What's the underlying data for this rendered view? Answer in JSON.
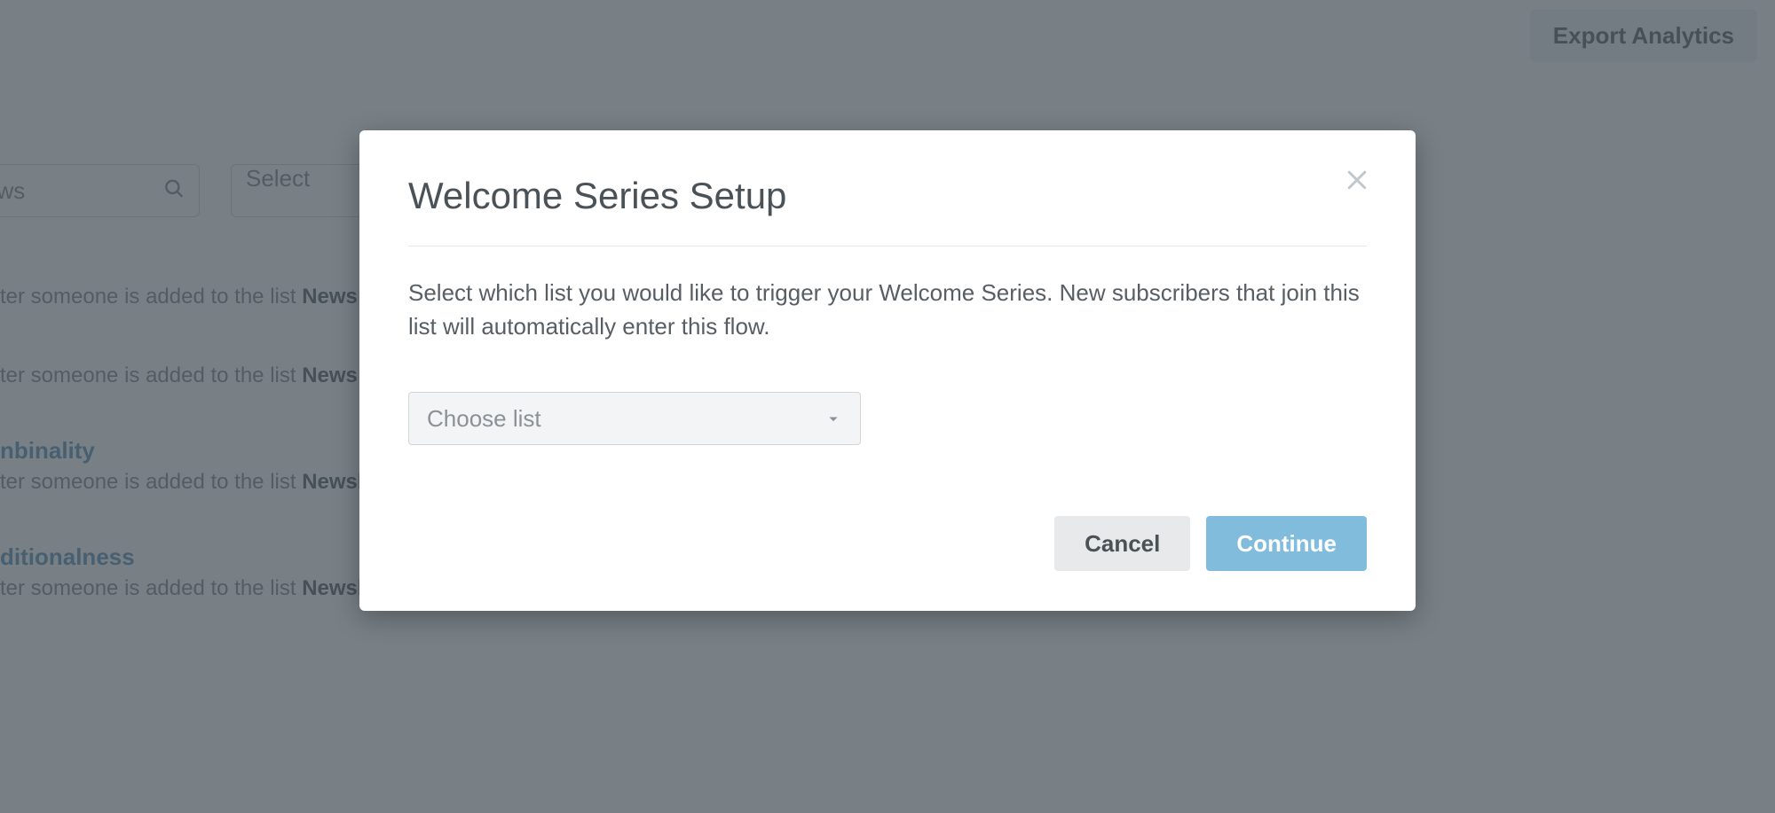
{
  "header": {
    "export_label": "Export Analytics"
  },
  "filters": {
    "search_placeholder": "ows",
    "secondary_placeholder": "Select"
  },
  "flows": [
    {
      "title_suffix": "",
      "desc_prefix": "ter someone is added to the list ",
      "list_name": "News"
    },
    {
      "title_suffix": "",
      "desc_prefix": "ter someone is added to the list ",
      "list_name": "News"
    },
    {
      "title_suffix": "nbinality",
      "desc_prefix": "ter someone is added to the list ",
      "list_name": "Newsletter"
    },
    {
      "title_suffix": "ditionalness",
      "desc_prefix": "ter someone is added to the list ",
      "list_name": "Newsletter"
    }
  ],
  "modal": {
    "title": "Welcome Series Setup",
    "description": "Select which list you would like to trigger your Welcome Series. New subscribers that join this list will automatically enter this flow.",
    "choose_placeholder": "Choose list",
    "cancel_label": "Cancel",
    "continue_label": "Continue"
  }
}
